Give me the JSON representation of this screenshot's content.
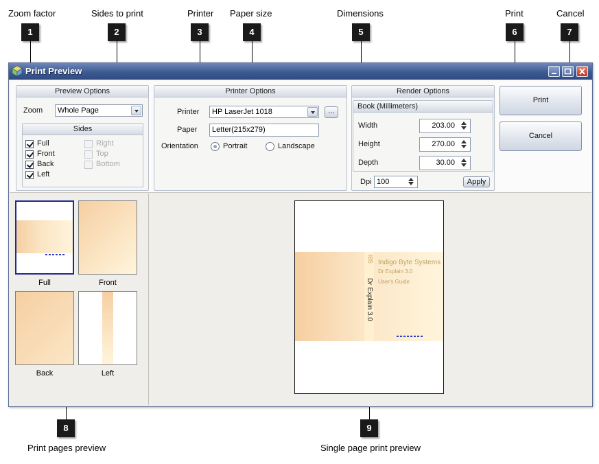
{
  "callouts": [
    {
      "number": "1",
      "label": "Zoom factor"
    },
    {
      "number": "2",
      "label": "Sides to print"
    },
    {
      "number": "3",
      "label": "Printer"
    },
    {
      "number": "4",
      "label": "Paper size"
    },
    {
      "number": "5",
      "label": "Dimensions"
    },
    {
      "number": "6",
      "label": "Print"
    },
    {
      "number": "7",
      "label": "Cancel"
    },
    {
      "number": "8",
      "label": "Print pages preview"
    },
    {
      "number": "9",
      "label": "Single page print preview"
    }
  ],
  "window": {
    "title": "Print Preview"
  },
  "preview_options": {
    "header": "Preview Options",
    "zoom_label": "Zoom",
    "zoom_value": "Whole Page",
    "sides_header": "Sides",
    "sides": [
      {
        "label": "Full",
        "checked": true,
        "enabled": true
      },
      {
        "label": "Front",
        "checked": true,
        "enabled": true
      },
      {
        "label": "Back",
        "checked": true,
        "enabled": true
      },
      {
        "label": "Left",
        "checked": true,
        "enabled": true
      },
      {
        "label": "Right",
        "checked": false,
        "enabled": false
      },
      {
        "label": "Top",
        "checked": false,
        "enabled": false
      },
      {
        "label": "Bottom",
        "checked": false,
        "enabled": false
      }
    ]
  },
  "printer_options": {
    "header": "Printer Options",
    "printer_label": "Printer",
    "printer_value": "HP LaserJet 1018",
    "browse_label": "...",
    "paper_label": "Paper",
    "paper_value": "Letter(215x279)",
    "orientation_label": "Orientation",
    "orientation_options": [
      "Portrait",
      "Landscape"
    ],
    "orientation_selected": "Portrait"
  },
  "render_options": {
    "header": "Render Options",
    "subheader": "Book (Millimeters)",
    "width_label": "Width",
    "width_value": "203.00",
    "height_label": "Height",
    "height_value": "270.00",
    "depth_label": "Depth",
    "depth_value": "30.00",
    "dpi_label": "Dpi",
    "dpi_value": "100",
    "apply_label": "Apply"
  },
  "actions": {
    "print_label": "Print",
    "cancel_label": "Cancel"
  },
  "thumbnails": [
    {
      "caption": "Full",
      "selected": true
    },
    {
      "caption": "Front",
      "selected": false
    },
    {
      "caption": "Back",
      "selected": false
    },
    {
      "caption": "Left",
      "selected": false
    }
  ],
  "book_cover": {
    "company": "Indigo Byte Systems",
    "product": "Dr Explain 3.0",
    "subtitle": "User's Guide",
    "spine_logo": "IBS",
    "spine_title": "Dr Explain 3.0"
  },
  "colors": {
    "title_bar": "#3d5a92",
    "window_bg": "#f0eeea",
    "selected_thumb": "#1e2a8a",
    "cover_gradient_start": "#f6cfa2",
    "cover_gradient_end": "#fff5dc",
    "cover_text": "#c0a060",
    "link_blue": "#2b3ec7"
  }
}
